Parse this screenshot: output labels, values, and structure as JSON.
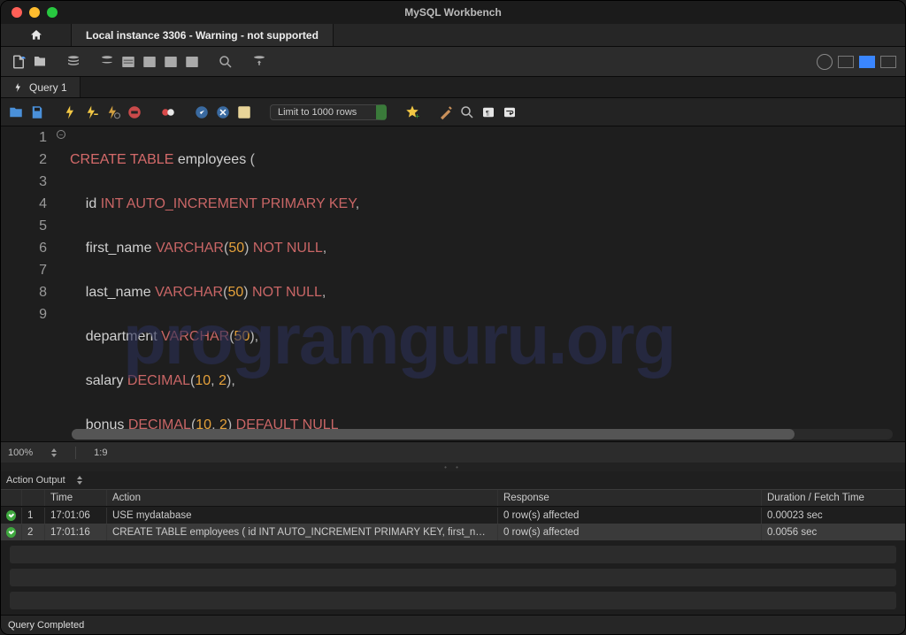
{
  "window": {
    "title": "MySQL Workbench"
  },
  "tabs": {
    "connection": "Local instance 3306 - Warning - not supported"
  },
  "query_tab": {
    "label": "Query 1"
  },
  "editor_toolbar": {
    "limit": "Limit to 1000 rows"
  },
  "code": {
    "lines": [
      {
        "n": "1"
      },
      {
        "n": "2"
      },
      {
        "n": "3"
      },
      {
        "n": "4"
      },
      {
        "n": "5"
      },
      {
        "n": "6"
      },
      {
        "n": "7"
      },
      {
        "n": "8"
      },
      {
        "n": "9"
      }
    ],
    "l1": {
      "kw1": "CREATE",
      "kw2": "TABLE",
      "id": "employees",
      "p": "("
    },
    "l2": {
      "id": "id",
      "t1": "INT",
      "t2": "AUTO_INCREMENT",
      "t3": "PRIMARY",
      "t4": "KEY",
      "p": ","
    },
    "l3": {
      "id": "first_name",
      "t": "VARCHAR",
      "p1": "(",
      "n": "50",
      "p2": ")",
      "kw1": "NOT",
      "kw2": "NULL",
      "pend": ","
    },
    "l4": {
      "id": "last_name",
      "t": "VARCHAR",
      "p1": "(",
      "n": "50",
      "p2": ")",
      "kw1": "NOT",
      "kw2": "NULL",
      "pend": ","
    },
    "l5": {
      "id": "department",
      "t": "VARCHAR",
      "p1": "(",
      "n": "50",
      "p2": ")",
      "pend": ","
    },
    "l6": {
      "id": "salary",
      "t": "DECIMAL",
      "p1": "(",
      "n1": "10",
      "c": ",",
      "n2": "2",
      "p2": ")",
      "pend": ","
    },
    "l7": {
      "id": "bonus",
      "t": "DECIMAL",
      "p1": "(",
      "n1": "10",
      "c": ",",
      "n2": "2",
      "p2": ")",
      "kw": "DEFAULT",
      "nl": "NULL"
    },
    "l8": {
      "p": ");"
    }
  },
  "watermark": "programguru.org",
  "status": {
    "zoom": "100%",
    "pos": "1:9"
  },
  "action_output": {
    "title": "Action Output",
    "cols": {
      "time": "Time",
      "action": "Action",
      "response": "Response",
      "duration": "Duration / Fetch Time"
    },
    "rows": [
      {
        "n": "1",
        "time": "17:01:06",
        "action": "USE mydatabase",
        "response": "0 row(s) affected",
        "duration": "0.00023 sec"
      },
      {
        "n": "2",
        "time": "17:01:16",
        "action": "CREATE TABLE employees (     id INT AUTO_INCREMENT PRIMARY KEY,     first_n…",
        "response": "0 row(s) affected",
        "duration": "0.0056 sec"
      }
    ]
  },
  "footer": {
    "status": "Query Completed"
  }
}
